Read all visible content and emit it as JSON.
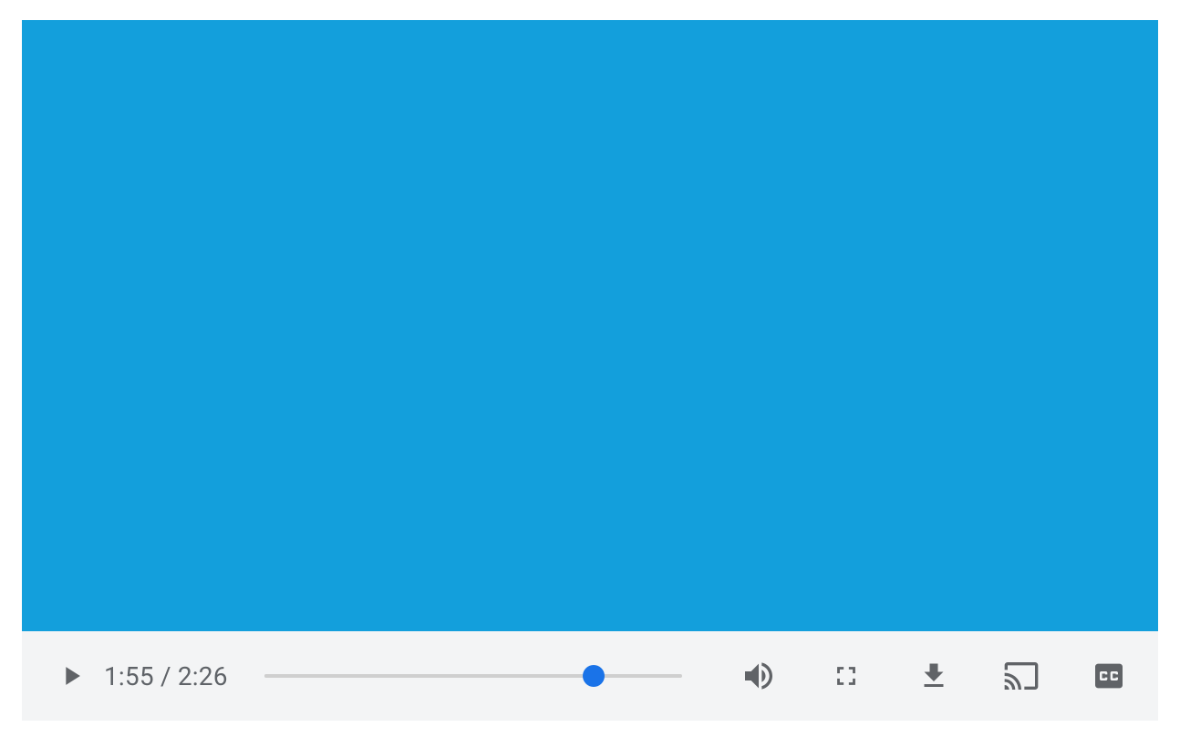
{
  "player": {
    "video_bg": "#139fdc",
    "current_time": "1:55",
    "duration": "2:26",
    "separator": " / ",
    "progress_pct": 78.8,
    "accent": "#1a73e8",
    "icon_color": "#606367",
    "controls_bg": "#f3f4f5",
    "icons": {
      "play": "play-icon",
      "volume": "volume-icon",
      "fullscreen": "fullscreen-icon",
      "download": "download-icon",
      "cast": "cast-icon",
      "captions": "captions-icon"
    },
    "captions_label": "CC"
  }
}
